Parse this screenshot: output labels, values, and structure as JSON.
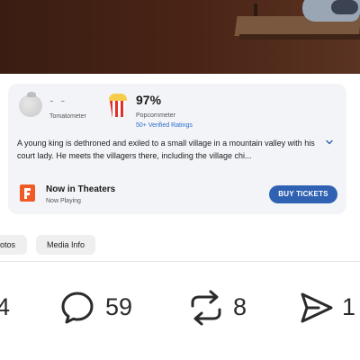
{
  "ratings": {
    "tomatometer": {
      "score": "- -",
      "label": "Tomatometer",
      "icon": "tomato-icon"
    },
    "popcornmeter": {
      "score": "97%",
      "label": "Popcornmeter",
      "verified": "50+ Verified Ratings",
      "icon": "popcorn-icon"
    }
  },
  "description": "A young king is dethroned and exiled to a small village in a mountain valley with his court lady. He meets the villagers there, including the village chi...",
  "showtimes": {
    "status": "Now in Theaters",
    "substatus": "Now Playing",
    "cta_label": "BUY TICKETS",
    "cta_color": "#2f62b3"
  },
  "tabs": [
    {
      "label": "otos"
    },
    {
      "label": "Media Info"
    }
  ],
  "actions": {
    "likes_partial": "4",
    "comments": "59",
    "reposts": "8",
    "shares_partial": "1"
  },
  "colors": {
    "accent": "#2f62b3",
    "popcorn_red": "#e0312b",
    "fandango_orange": "#f15a24"
  }
}
